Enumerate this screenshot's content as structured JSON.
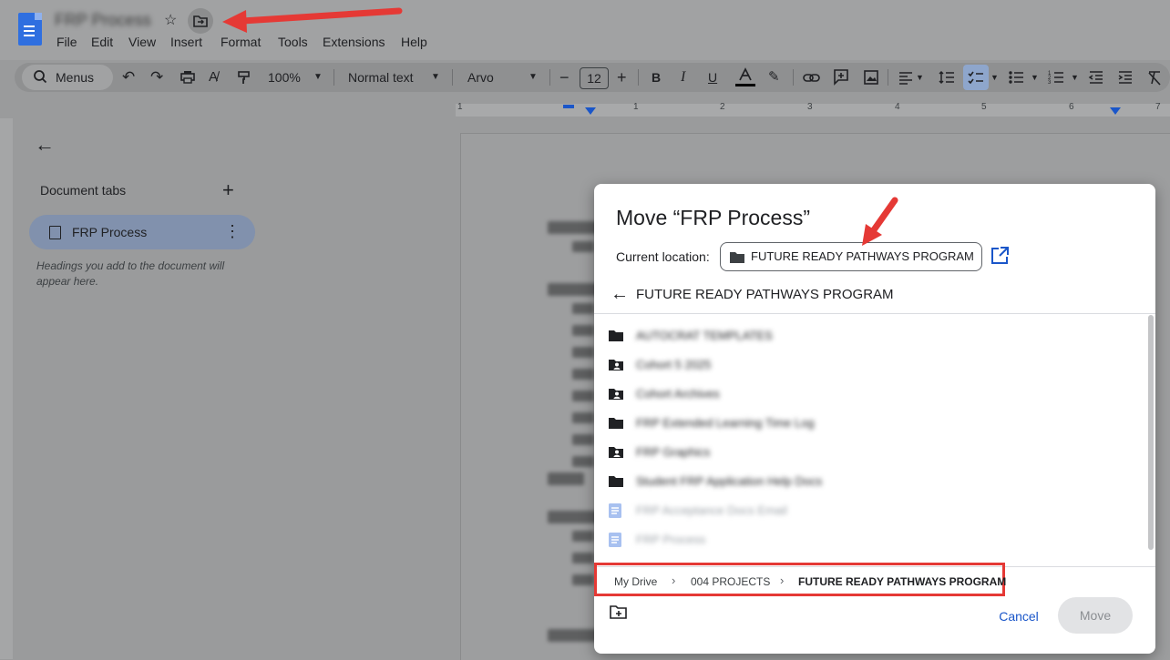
{
  "header": {
    "doc_title": "FRP Process",
    "menu": [
      "File",
      "Edit",
      "View",
      "Insert",
      "Format",
      "Tools",
      "Extensions",
      "Help"
    ]
  },
  "toolbar": {
    "search_label": "Menus",
    "zoom": "100%",
    "style": "Normal text",
    "font": "Arvo",
    "font_size": "12"
  },
  "ruler": {
    "marks": [
      "1",
      "1",
      "2",
      "3",
      "4",
      "5",
      "6",
      "7"
    ]
  },
  "sidebar": {
    "heading": "Document tabs",
    "tab_label": "FRP Process",
    "hint": "Headings you add to the document will appear here."
  },
  "dialog": {
    "title": "Move “FRP Process”",
    "current_location_label": "Current location:",
    "current_location": "FUTURE READY PATHWAYS PROGRAM",
    "folder_heading": "FUTURE READY PATHWAYS PROGRAM",
    "items": [
      {
        "name": "AUTOCRAT TEMPLATES",
        "type": "folder"
      },
      {
        "name": "Cohort 5 2025",
        "type": "shared-folder"
      },
      {
        "name": "Cohort Archives",
        "type": "shared-folder"
      },
      {
        "name": "FRP Extended Learning Time Log",
        "type": "folder"
      },
      {
        "name": "FRP Graphics",
        "type": "shared-folder"
      },
      {
        "name": "Student FRP Application Help Docs",
        "type": "folder"
      },
      {
        "name": "FRP Acceptance Docs Email",
        "type": "doc"
      },
      {
        "name": "FRP Process",
        "type": "doc"
      }
    ],
    "breadcrumb": [
      "My Drive",
      "004 PROJECTS",
      "FUTURE READY PATHWAYS PROGRAM"
    ],
    "cancel_label": "Cancel",
    "move_label": "Move"
  },
  "colors": {
    "accent": "#1a73e8",
    "annotation": "#e53935"
  }
}
